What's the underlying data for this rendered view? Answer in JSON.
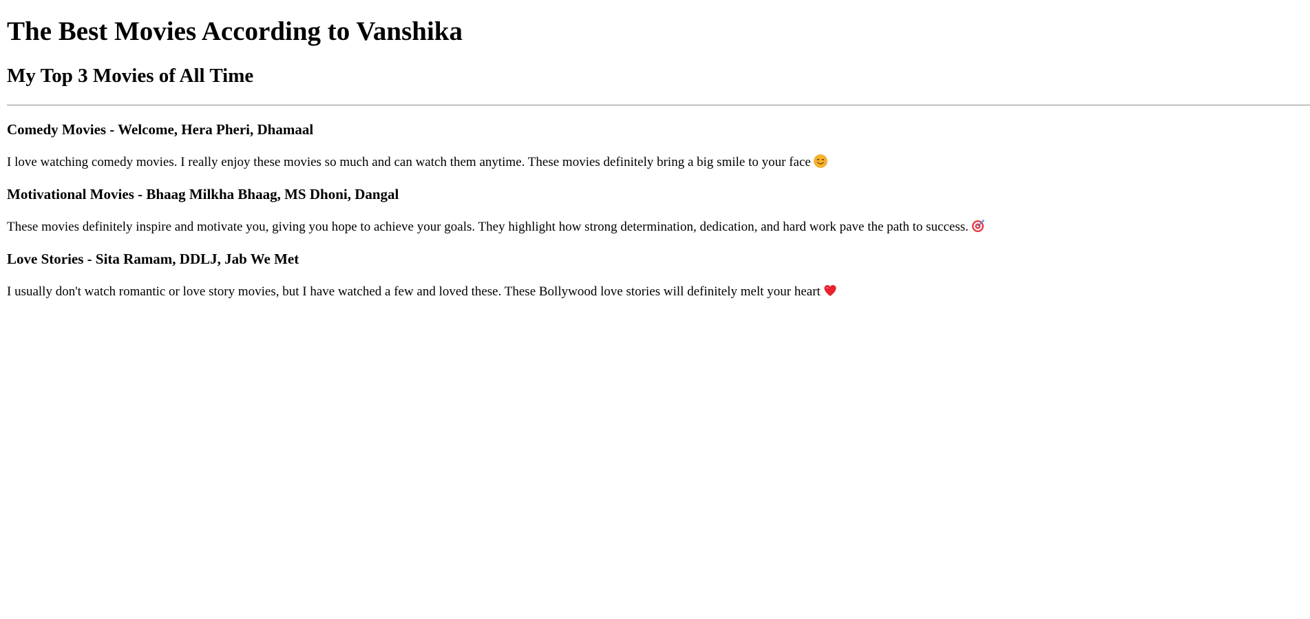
{
  "page": {
    "title": "The Best Movies According to Vanshika",
    "subtitle": "My Top 3 Movies of All Time"
  },
  "sections": [
    {
      "heading": "Comedy Movies - Welcome, Hera Pheri, Dhamaal",
      "text": "I love watching comedy movies. I really enjoy these movies so much and can watch them anytime. These movies definitely bring a big smile to your face",
      "icon": "smiling-face-icon"
    },
    {
      "heading": "Motivational Movies - Bhaag Milkha Bhaag, MS Dhoni, Dangal",
      "text": "These movies definitely inspire and motivate you, giving you hope to achieve your goals. They highlight how strong determination, dedication, and hard work pave the path to success.",
      "icon": "target-dart-icon"
    },
    {
      "heading": "Love Stories - Sita Ramam, DDLJ, Jab We Met",
      "text": "I usually don't watch romantic or love story movies, but I have watched a few and loved these. These Bollywood love stories will definitely melt your heart",
      "icon": "red-heart-icon"
    }
  ]
}
